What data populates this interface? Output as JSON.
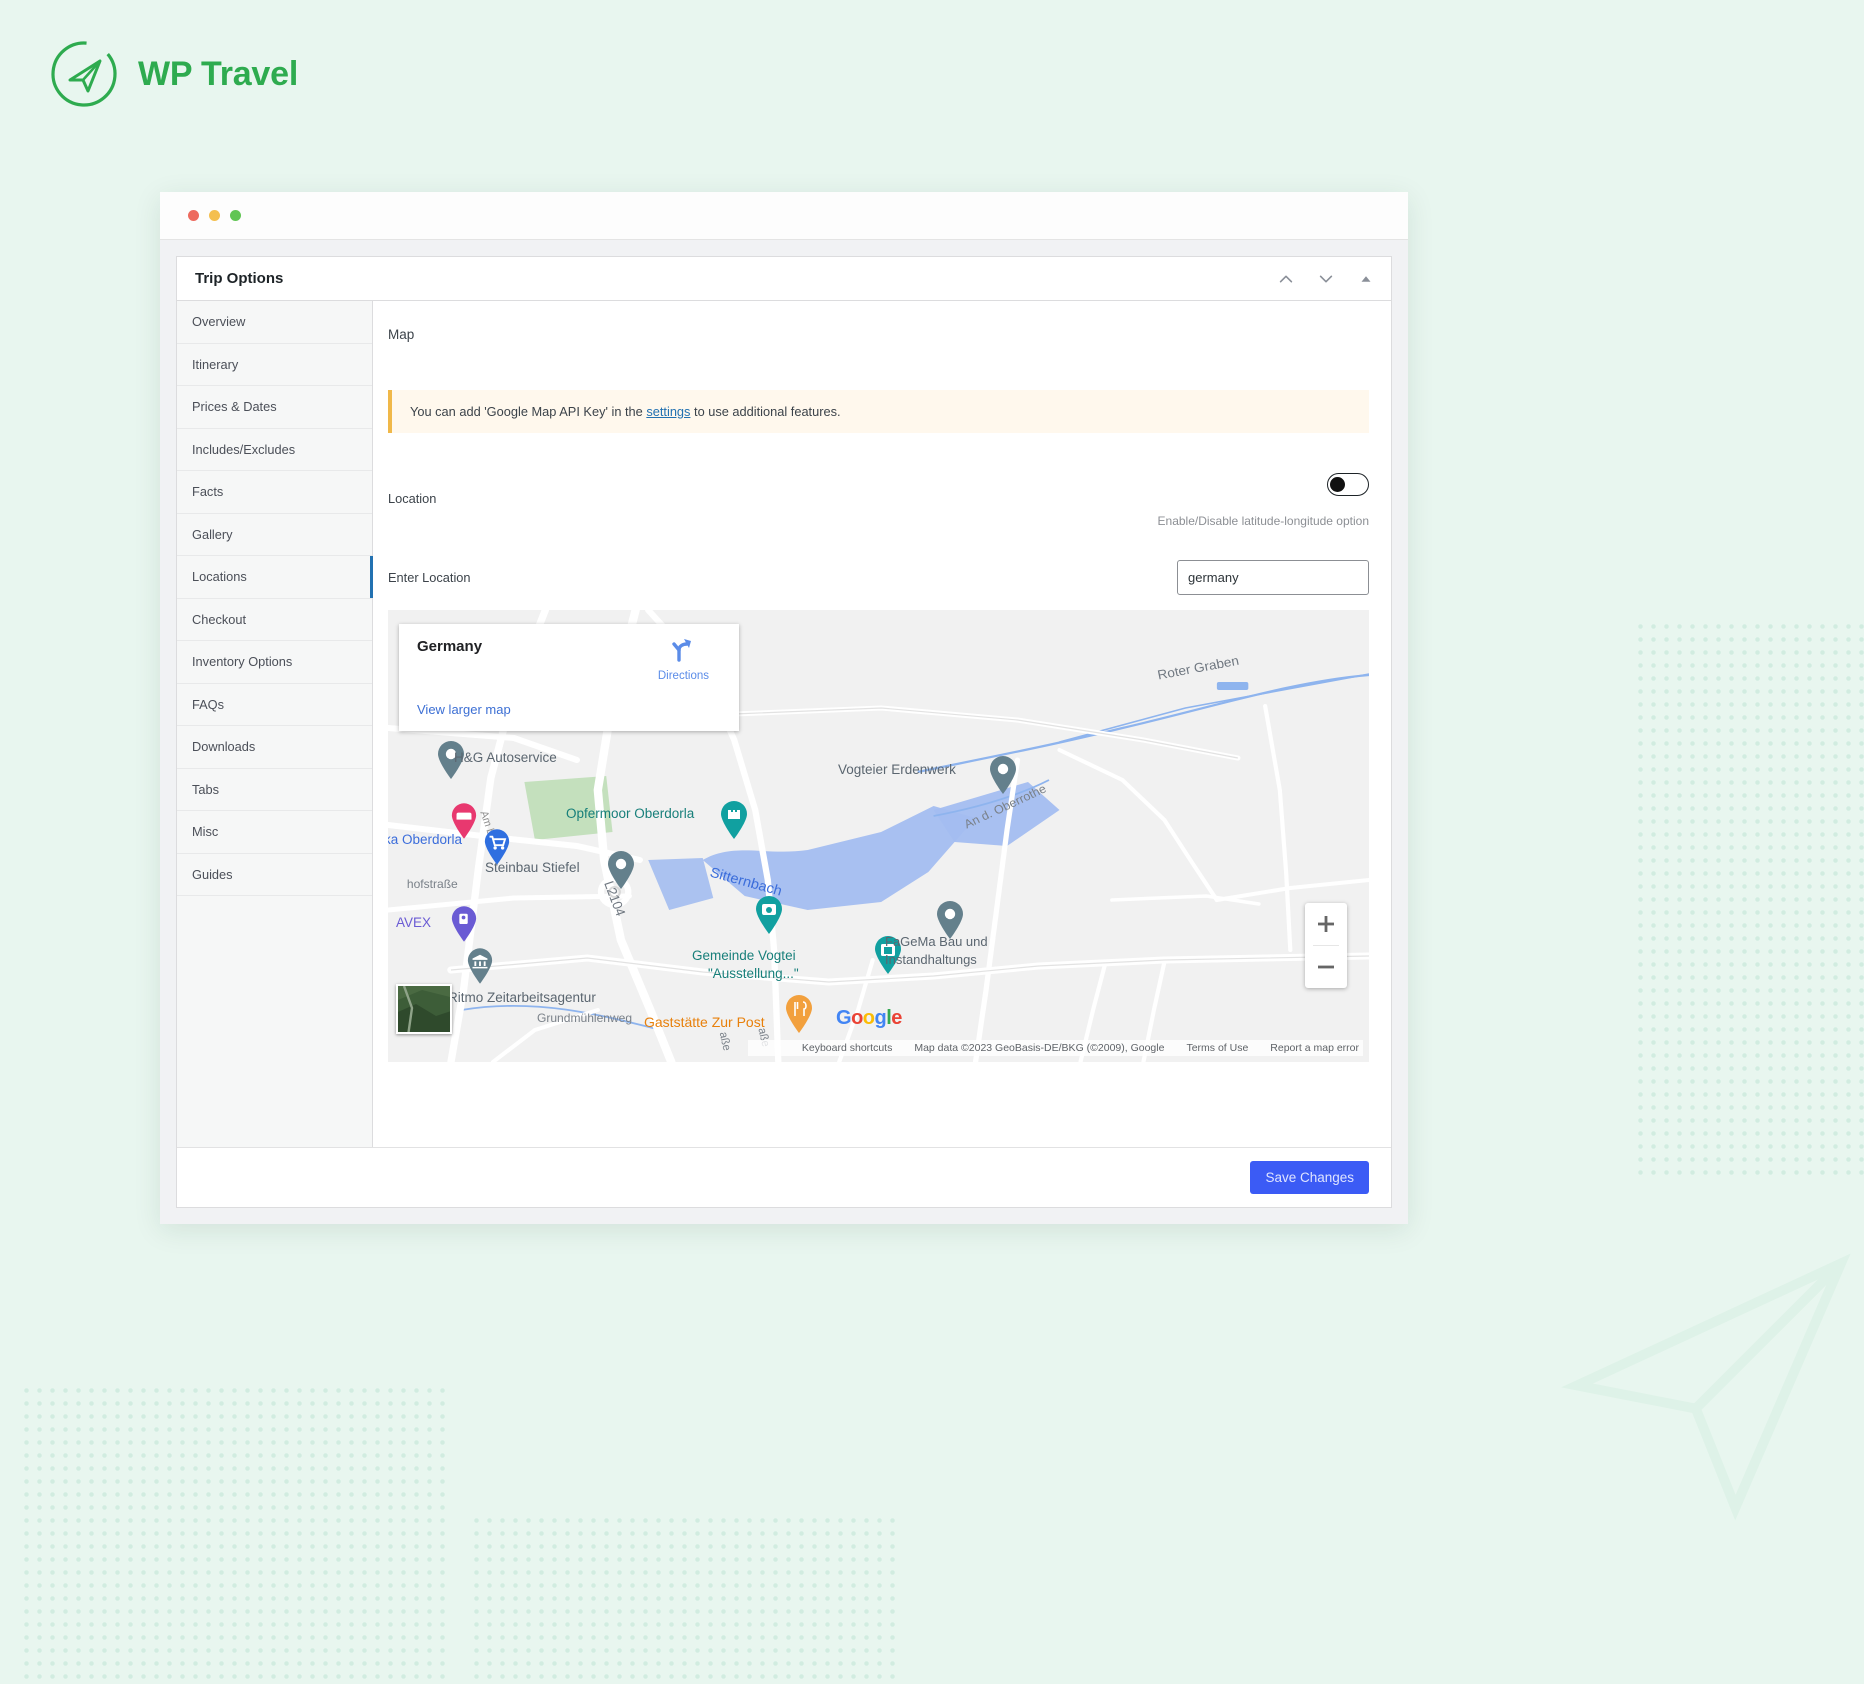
{
  "brand": {
    "name": "WP Travel",
    "icon": "paper-plane-icon",
    "color": "#2eab4f"
  },
  "window": {
    "traffic_lights": [
      "close",
      "minimize",
      "maximize"
    ]
  },
  "panel": {
    "title": "Trip Options",
    "actions": [
      {
        "name": "move-up-icon",
        "glyph": "chevron-up"
      },
      {
        "name": "move-down-icon",
        "glyph": "chevron-down"
      },
      {
        "name": "collapse-icon",
        "glyph": "triangle-up"
      }
    ]
  },
  "sidebar": {
    "items": [
      {
        "label": "Overview",
        "active": false
      },
      {
        "label": "Itinerary",
        "active": false
      },
      {
        "label": "Prices & Dates",
        "active": false
      },
      {
        "label": "Includes/Excludes",
        "active": false
      },
      {
        "label": "Facts",
        "active": false
      },
      {
        "label": "Gallery",
        "active": false
      },
      {
        "label": "Locations",
        "active": true
      },
      {
        "label": "Checkout",
        "active": false
      },
      {
        "label": "Inventory Options",
        "active": false
      },
      {
        "label": "FAQs",
        "active": false
      },
      {
        "label": "Downloads",
        "active": false
      },
      {
        "label": "Tabs",
        "active": false
      },
      {
        "label": "Misc",
        "active": false
      },
      {
        "label": "Guides",
        "active": false
      }
    ]
  },
  "content": {
    "title": "Map",
    "notice": {
      "before": "You can add 'Google Map API Key' in the ",
      "link": "settings",
      "after": " to use additional features."
    },
    "location": {
      "label": "Location",
      "toggle_state": "off",
      "toggle_help": "Enable/Disable latitude-longitude option"
    },
    "enter_location": {
      "label": "Enter Location",
      "value": "germany",
      "placeholder": "Enter Location"
    }
  },
  "map": {
    "info_card": {
      "title": "Germany",
      "directions_label": "Directions",
      "view_larger_label": "View larger map"
    },
    "labels": [
      {
        "text": "H&G Autoservice",
        "color": "grey"
      },
      {
        "text": "Vogteier Erdenwerk",
        "color": "grey"
      },
      {
        "text": "Opfermoor Oberdorla",
        "color": "teal"
      },
      {
        "text": "ka Oberdorla",
        "color": "blue"
      },
      {
        "text": "Steinbau Stiefel",
        "color": "grey"
      },
      {
        "text": "Sitternbach",
        "color": "blue"
      },
      {
        "text": "AVEX",
        "color": "purple"
      },
      {
        "text": "FaGeMa Bau und",
        "color": "grey"
      },
      {
        "text": "Instandhaltungs",
        "color": "grey"
      },
      {
        "text": "Gemeinde Vogtei",
        "color": "teal"
      },
      {
        "text": "\"Ausstellung...\"",
        "color": "teal"
      },
      {
        "text": "Ritmo Zeitarbeitsagentur",
        "color": "grey"
      },
      {
        "text": "Gaststätte Zur Post",
        "color": "orange"
      }
    ],
    "streets": [
      "Am bhf",
      "Roter Graben",
      "An d. Oberrothe",
      "L2104",
      "hofstraße",
      "Grundmühlenweg",
      "aße"
    ],
    "zoom_controls": {
      "zoom_in": "+",
      "zoom_out": "−"
    },
    "google_logo": "Google",
    "attribution": [
      "Keyboard shortcuts",
      "Map data ©2023 GeoBasis-DE/BKG (©2009), Google",
      "Terms of Use",
      "Report a map error"
    ]
  },
  "footer": {
    "save_label": "Save Changes",
    "save_color": "#3b5bf5"
  }
}
